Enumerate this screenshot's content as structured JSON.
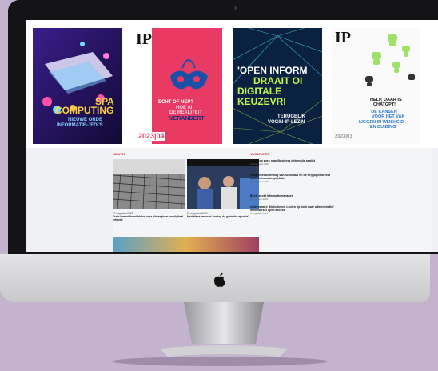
{
  "covers": [
    {
      "lines": [
        "SPA",
        "COMPUTING",
        "NIEUWE ORDE",
        "INFORMATIE-JEDI'S"
      ]
    },
    {
      "brand": "IP",
      "lines": [
        "ECHT OF NEP?",
        "HOE AI",
        "DE REALITEIT",
        "VERANDERT"
      ],
      "issue": "2023|04"
    },
    {
      "lines": [
        "'OPEN INFORM",
        "DRAAIT OI",
        "DIGITALE",
        "KEUZEVRI"
      ],
      "sub": "TERUGBLIK",
      "sub2": "VOGIN-IP-LEZIN"
    },
    {
      "brand": "IP",
      "lines": [
        "HELP, DAAR IS",
        "CHATGPT!",
        "'DE KANSEN",
        "VOOR HET VAK",
        "LIGGEN IN WIJSHEID",
        "EN DUIDING'"
      ],
      "issue": "2023|03"
    }
  ],
  "sections": {
    "news": "NIEUWS",
    "vacancies": "VACATURES"
  },
  "news_items": [
    {
      "date": "27 augustus 2023",
      "title": "Duits financiële middelen voor uitdaagbaar om digitaal erfgoed"
    },
    {
      "date": "26 augustus 2023",
      "title": "Mediafans lanceert 'verlieg de gedrukte aprecia'"
    }
  ],
  "vacancies": [
    {
      "title": "NCRB op zoek naar Business informatie analist",
      "date": "27 augustus 2023"
    },
    {
      "title": "Hooghmeoordenhog van Schiebaal en de Krijgsgeworeerd zoekt informatiespecialist",
      "date": "27 augustus 2023"
    },
    {
      "title": "BZyG zoekt informatiemanager",
      "date": "8 augustus 2023"
    },
    {
      "title": "Universitaire Bibliotheken Leiden op zoek naar administratief medewerker open access",
      "date": "8 augustus 2023"
    }
  ],
  "colors": {
    "background": "#c3b3cd",
    "bezel": "#141416",
    "accent": "#c1272d"
  }
}
